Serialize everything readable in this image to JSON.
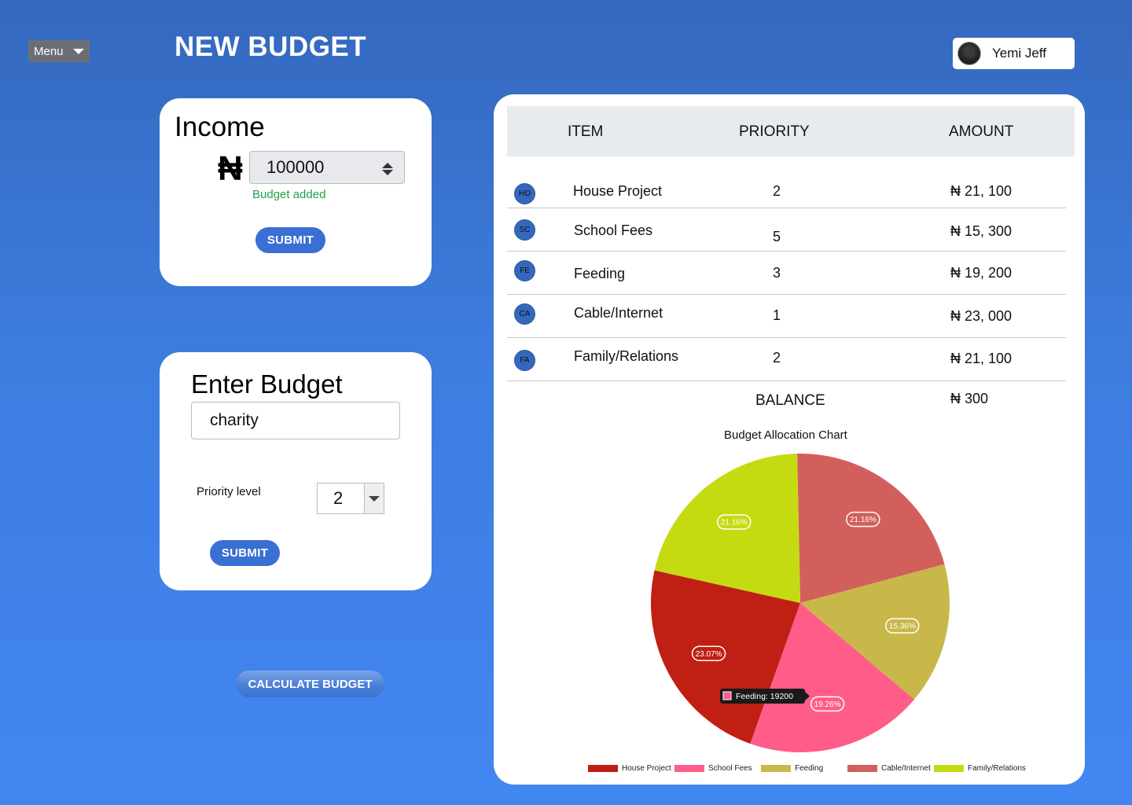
{
  "header": {
    "menu_label": "Menu",
    "page_title": "NEW BUDGET",
    "user_name": "Yemi Jeff"
  },
  "income": {
    "heading": "Income",
    "currency_symbol": "₦",
    "amount_value": "100000",
    "status_text": "Budget added",
    "submit_label": "SUBMIT"
  },
  "enter_budget": {
    "heading": "Enter Budget",
    "item_value": "charity",
    "priority_label": "Priority level",
    "priority_value": "2",
    "submit_label": "SUBMIT"
  },
  "calculate_label": "CALCULATE BUDGET",
  "table": {
    "headers": [
      "ITEM",
      "PRIORITY",
      "AMOUNT"
    ],
    "rows": [
      {
        "badge": "HO",
        "item": "House Project",
        "priority": "2",
        "amount": "₦ 21, 100"
      },
      {
        "badge": "SC",
        "item": "School Fees",
        "priority": "5",
        "amount": "₦ 15, 300"
      },
      {
        "badge": "FE",
        "item": "Feeding",
        "priority": "3",
        "amount": "₦ 19, 200"
      },
      {
        "badge": "CA",
        "item": "Cable/Internet",
        "priority": "1",
        "amount": "₦ 23, 000"
      },
      {
        "badge": "FA",
        "item": "Family/Relations",
        "priority": "2",
        "amount": "₦ 21, 100"
      }
    ],
    "balance_label": "BALANCE",
    "balance_value": "₦ 300"
  },
  "chart_data": {
    "type": "pie",
    "title": "Budget Allocation Chart",
    "categories": [
      "House Project",
      "School Fees",
      "Feeding",
      "Cable/Internet",
      "Family/Relations"
    ],
    "values": [
      23.07,
      19.26,
      15.36,
      21.16,
      21.16
    ],
    "value_labels": [
      "23.07%",
      "19.26%",
      "15.36%",
      "21.16%",
      "21.16%"
    ],
    "colors": [
      "#c01f14",
      "#ff5c8a",
      "#c8b84a",
      "#d35f5c",
      "#c5db11"
    ],
    "legend": [
      "House Project",
      "School Fees",
      "Feeding",
      "Cable/Internet",
      "Family/Relations"
    ],
    "legend_colors": [
      "#c01f14",
      "#ff5c8a",
      "#c8b84a",
      "#d35f5c",
      "#c5db11"
    ],
    "legend_position": "bottom",
    "tooltip": "Feeding: 19200"
  }
}
